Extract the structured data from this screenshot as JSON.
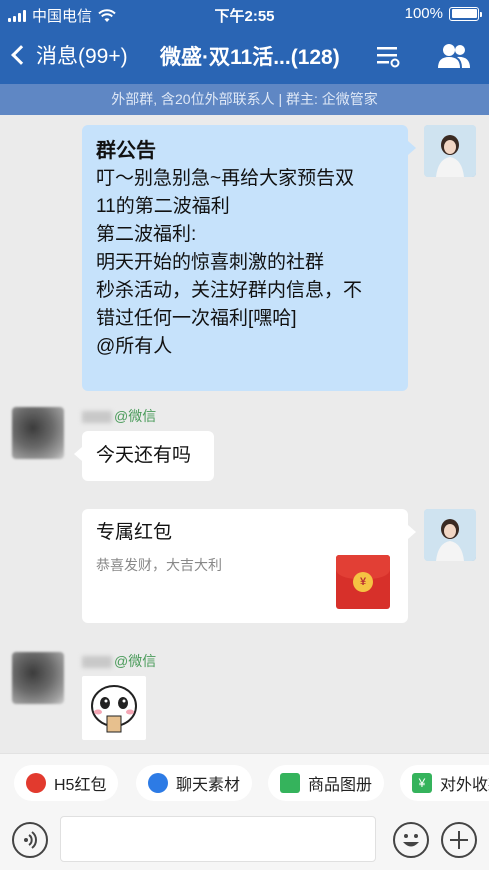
{
  "status_bar": {
    "carrier": "中国电信",
    "time": "下午2:55",
    "battery": "100%"
  },
  "nav": {
    "back_label": "消息(99+)",
    "title": "微盛·双11活...(128)"
  },
  "group_info": "外部群, 含20位外部联系人 | 群主: 企微管家",
  "messages": {
    "announcement": {
      "title": "群公告",
      "body": "叮～别急别急~再给大家预告双\n11的第二波福利\n第二波福利:\n      明天开始的惊喜刺激的社群\n秒杀活动，关注好群内信息，不\n错过任何一次福利[嘿哈]\n@所有人"
    },
    "msg2": {
      "sender_suffix": "@微信",
      "text": "今天还有吗"
    },
    "red_packet": {
      "title": "专属红包",
      "subtitle": "恭喜发财，大吉大利",
      "coin_symbol": "¥"
    },
    "msg4": {
      "sender_suffix": "@微信"
    }
  },
  "quick_actions": [
    {
      "label": "H5红包",
      "icon": "red-packet-icon"
    },
    {
      "label": "聊天素材",
      "icon": "weisheng-icon"
    },
    {
      "label": "商品图册",
      "icon": "catalog-icon"
    },
    {
      "label": "对外收款",
      "icon": "payment-icon"
    }
  ],
  "colors": {
    "header_blue": "#2a65b4",
    "subbar_blue": "#5f87c4",
    "bubble_blue": "#c6e2fb",
    "sender_green": "#4a9b5a",
    "red_packet": "#d7302a"
  }
}
